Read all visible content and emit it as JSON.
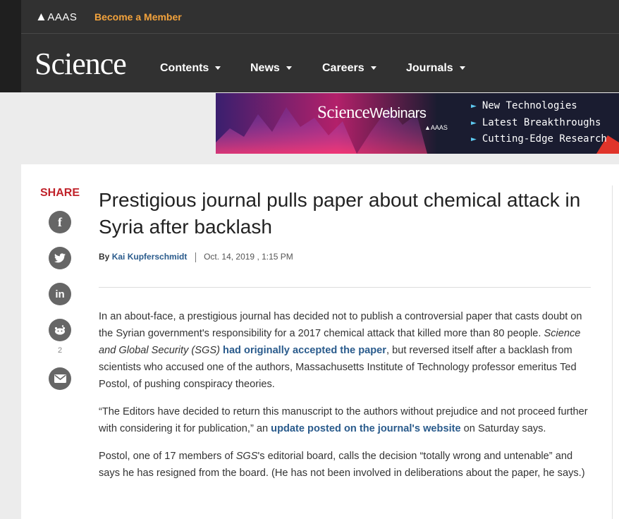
{
  "header": {
    "org": "AAAS",
    "member_link": "Become a Member",
    "logo": "Science",
    "nav": [
      "Contents",
      "News",
      "Careers",
      "Journals"
    ]
  },
  "banner": {
    "logo_science": "Science",
    "logo_webinars": "Webinars",
    "logo_org": "AAAS",
    "items": [
      "New Technologies",
      "Latest Breakthroughs",
      "Cutting-Edge Research"
    ]
  },
  "share": {
    "label": "SHARE",
    "reddit_count": "2"
  },
  "article": {
    "title": "Prestigious journal pulls paper about chemical attack in Syria after backlash",
    "by": "By",
    "author": "Kai Kupferschmidt",
    "date": "Oct. 14, 2019 , 1:15 PM",
    "p1": {
      "a": "In an about-face, a prestigious journal has decided not to publish a controversial paper that casts doubt on the Syrian government's responsibility for a 2017 chemical attack that killed more than 80 people. ",
      "em": "Science and Global Security (SGS)",
      "link": "had originally accepted the paper",
      "b": ", but reversed itself after a backlash from scientists who accused one of the authors, Massachusetts Institute of Technology professor emeritus Ted Postol, of pushing conspiracy theories."
    },
    "p2": {
      "a": "“The Editors have decided to return this manuscript to the authors without prejudice and not proceed further with considering it for publication,” an ",
      "link": "update posted on the journal's website",
      "b": " on Saturday says."
    },
    "p3": {
      "a": "Postol, one of 17 members of ",
      "em": "SGS",
      "b": "'s editorial board, calls the decision “totally wrong and untenable” and says he has resigned from the board. (He has not been involved in deliberations about the paper, he says.)"
    }
  },
  "colors": {
    "header_bg": "#313131",
    "member_accent": "#f2a23c",
    "share_red": "#c0222a",
    "link_blue": "#2a5b8c"
  }
}
